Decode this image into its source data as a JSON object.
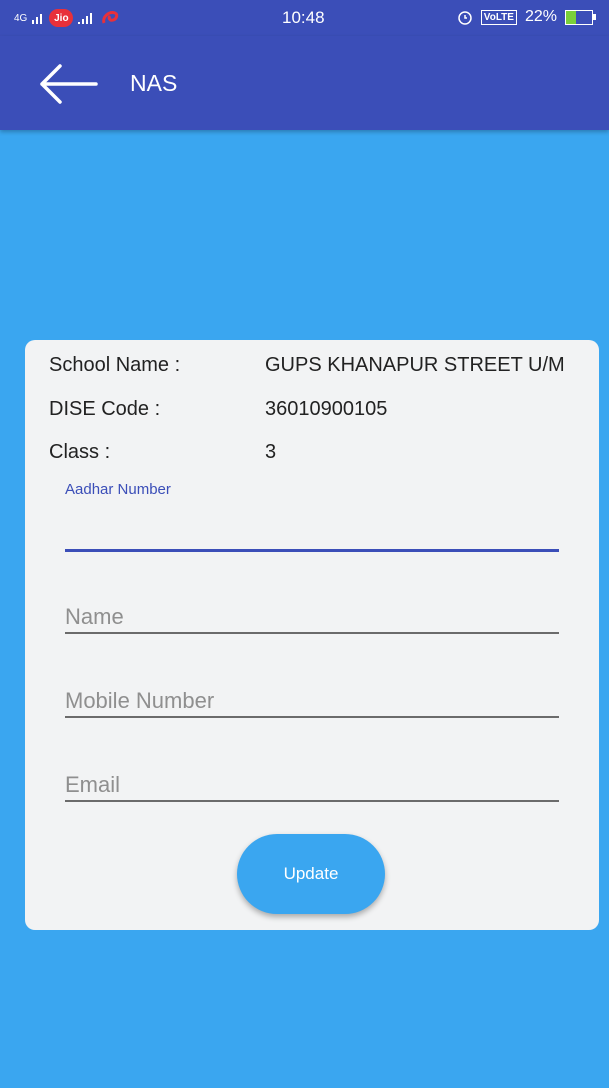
{
  "status_bar": {
    "network_left": "4G",
    "carrier": "Jio",
    "time": "10:48",
    "volte": "VoLTE",
    "battery": "22%",
    "battery_level": 0.22
  },
  "app_bar": {
    "title": "NAS",
    "back_icon": "arrow-left-icon"
  },
  "card": {
    "school_name_label": "School Name :",
    "school_name_value": "GUPS KHANAPUR STREET U/M",
    "dise_code_label": "DISE Code :",
    "dise_code_value": "36010900105",
    "class_label": "Class :",
    "class_value": "3"
  },
  "form": {
    "aadhar_label": "Aadhar Number",
    "aadhar_value": "",
    "name_placeholder": "Name",
    "mobile_placeholder": "Mobile Number",
    "email_placeholder": "Email",
    "update_label": "Update"
  },
  "colors": {
    "primary": "#3b4eb8",
    "background": "#3aa6f0",
    "card": "#f2f3f4"
  }
}
